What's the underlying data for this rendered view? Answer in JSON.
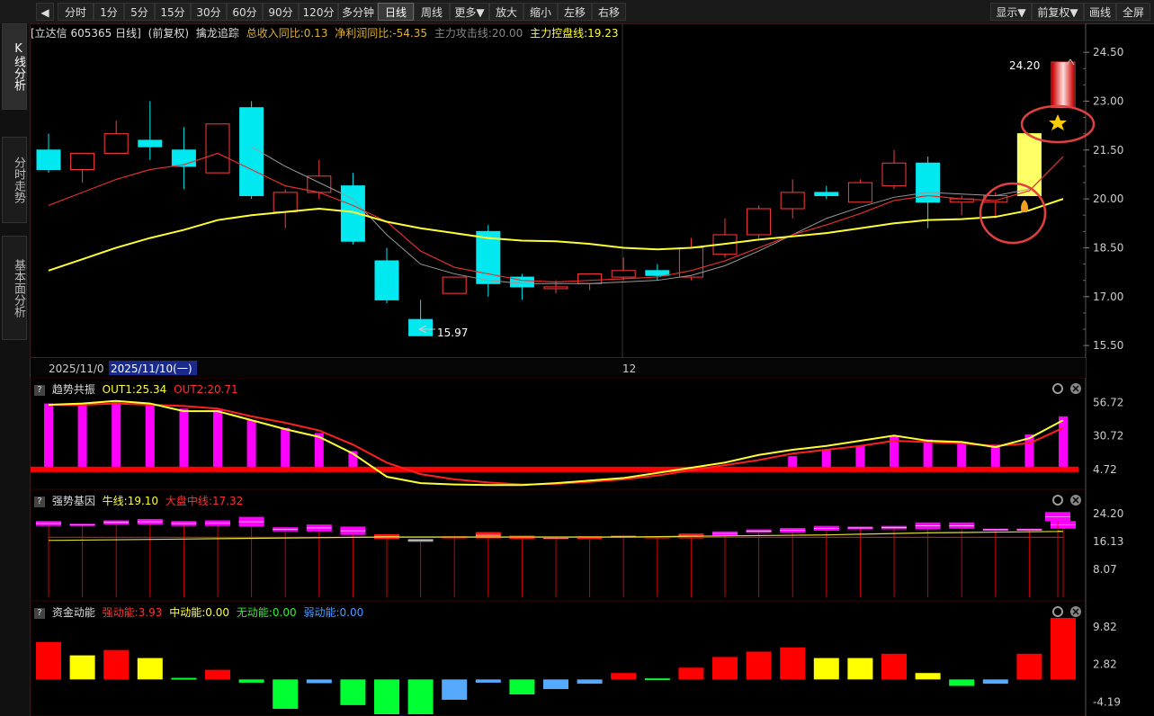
{
  "toolbar": {
    "back_icon": "back-arrow-icon",
    "buttons": [
      "分时",
      "1分",
      "5分",
      "15分",
      "30分",
      "60分",
      "90分",
      "120分",
      "多分钟",
      "日线",
      "周线",
      "更多▼",
      "放大",
      "缩小",
      "左移",
      "右移"
    ],
    "active": "日线",
    "right_buttons": [
      "显示▼",
      "前复权▼",
      "画线",
      "全屏"
    ]
  },
  "side_tabs": [
    "K线分析",
    "分时走势",
    "基本面分析"
  ],
  "main_chart": {
    "header": {
      "stock": "[立达信 605365 日线]",
      "adjust": "(前复权)",
      "indicator": "擒龙追踪",
      "rev": "总收入同比:0.13",
      "profit": "净利润同比:-54.35",
      "attack": "主力攻击线:20.00",
      "control": "主力控盘线:19.23"
    },
    "y_labels": [
      "24.50",
      "23.00",
      "21.50",
      "20.00",
      "18.50",
      "17.00",
      "15.50"
    ],
    "high_label": "24.20",
    "low_label": "15.97",
    "date_label_1": "2025/11/0",
    "date_label_2": "2025/11/10(一)",
    "month_label": "12",
    "colors": {
      "up": "#ff3c3c",
      "down": "#00e8f0",
      "ma_yellow": "#ffff33",
      "ma_red": "#e03030",
      "ma_gray": "#9a9a9a",
      "circle": "#e04040"
    }
  },
  "chart_data": [
    {
      "type": "candlestick",
      "title": "",
      "ylim": [
        15.2,
        25.0
      ],
      "y_ticks": [
        24.5,
        23.0,
        21.5,
        20.0,
        18.5,
        17.0,
        15.5
      ],
      "candles": [
        {
          "o": 21.5,
          "h": 22.0,
          "l": 20.8,
          "c": 20.9
        },
        {
          "o": 20.9,
          "h": 21.4,
          "l": 20.5,
          "c": 21.4
        },
        {
          "o": 21.4,
          "h": 22.4,
          "l": 21.4,
          "c": 22.0
        },
        {
          "o": 21.8,
          "h": 23.0,
          "l": 21.2,
          "c": 21.6
        },
        {
          "o": 21.5,
          "h": 22.2,
          "l": 20.3,
          "c": 21.0
        },
        {
          "o": 20.8,
          "h": 22.3,
          "l": 20.8,
          "c": 22.3
        },
        {
          "o": 22.8,
          "h": 23.0,
          "l": 20.0,
          "c": 20.1
        },
        {
          "o": 19.6,
          "h": 20.3,
          "l": 19.1,
          "c": 20.2
        },
        {
          "o": 20.2,
          "h": 21.2,
          "l": 20.0,
          "c": 20.7
        },
        {
          "o": 20.4,
          "h": 20.8,
          "l": 18.6,
          "c": 18.7
        },
        {
          "o": 18.1,
          "h": 18.5,
          "l": 16.8,
          "c": 16.9
        },
        {
          "o": 16.3,
          "h": 16.9,
          "l": 15.97,
          "c": 15.8
        },
        {
          "o": 17.1,
          "h": 17.6,
          "l": 17.1,
          "c": 17.6
        },
        {
          "o": 19.0,
          "h": 19.2,
          "l": 17.0,
          "c": 17.4
        },
        {
          "o": 17.6,
          "h": 17.7,
          "l": 16.9,
          "c": 17.3
        },
        {
          "o": 17.3,
          "h": 17.5,
          "l": 17.1,
          "c": 17.3
        },
        {
          "o": 17.4,
          "h": 17.7,
          "l": 17.2,
          "c": 17.7
        },
        {
          "o": 17.6,
          "h": 18.2,
          "l": 17.5,
          "c": 17.8
        },
        {
          "o": 17.8,
          "h": 18.0,
          "l": 17.5,
          "c": 17.65
        },
        {
          "o": 17.6,
          "h": 18.8,
          "l": 17.5,
          "c": 18.5
        },
        {
          "o": 18.3,
          "h": 19.4,
          "l": 18.2,
          "c": 18.9
        },
        {
          "o": 18.9,
          "h": 19.8,
          "l": 18.8,
          "c": 19.7
        },
        {
          "o": 19.7,
          "h": 20.6,
          "l": 19.4,
          "c": 20.2
        },
        {
          "o": 20.2,
          "h": 20.4,
          "l": 20.0,
          "c": 20.1
        },
        {
          "o": 19.9,
          "h": 20.6,
          "l": 19.9,
          "c": 20.5
        },
        {
          "o": 20.4,
          "h": 21.5,
          "l": 20.3,
          "c": 21.1
        },
        {
          "o": 21.1,
          "h": 21.3,
          "l": 19.1,
          "c": 19.9
        },
        {
          "o": 19.9,
          "h": 20.1,
          "l": 19.5,
          "c": 20.0
        },
        {
          "o": 19.9,
          "h": 20.2,
          "l": 19.4,
          "c": 20.1
        },
        {
          "o": 22.0,
          "h": 22.0,
          "l": 20.1,
          "c": 20.1
        },
        {
          "o": 22.8,
          "h": 24.2,
          "l": 22.8,
          "c": 24.2
        }
      ],
      "ma_yellow": [
        17.8,
        18.15,
        18.5,
        18.8,
        19.05,
        19.35,
        19.5,
        19.6,
        19.7,
        19.6,
        19.3,
        19.1,
        18.95,
        18.8,
        18.72,
        18.7,
        18.62,
        18.5,
        18.45,
        18.5,
        18.62,
        18.75,
        18.85,
        18.95,
        19.1,
        19.25,
        19.35,
        19.38,
        19.45,
        19.65,
        20.0
      ],
      "ma_red": [
        19.8,
        20.2,
        20.6,
        20.9,
        21.05,
        21.4,
        20.9,
        20.4,
        20.2,
        19.8,
        19.3,
        18.4,
        17.9,
        17.7,
        17.5,
        17.45,
        17.5,
        17.55,
        17.6,
        17.8,
        18.1,
        18.5,
        18.9,
        19.2,
        19.55,
        19.95,
        20.1,
        20.0,
        19.95,
        20.25,
        21.3
      ],
      "ma_gray": [
        null,
        null,
        null,
        null,
        null,
        null,
        21.6,
        21.0,
        20.5,
        20.0,
        18.9,
        18.0,
        17.7,
        17.5,
        17.4,
        17.4,
        17.4,
        17.45,
        17.5,
        17.65,
        17.95,
        18.4,
        18.9,
        19.4,
        19.75,
        20.05,
        20.2,
        20.15,
        20.1,
        20.3,
        null
      ]
    },
    {
      "type": "bar",
      "title": "趋势共振",
      "out1_label": "OUT1:25.34",
      "out2_label": "OUT2:20.71",
      "y_labels": [
        "56.72",
        "30.72",
        "4.72"
      ],
      "ylim": [
        -8,
        62
      ],
      "baseline": 4.72,
      "bars": [
        56.0,
        56.0,
        57.0,
        55.0,
        52.0,
        51.0,
        43.0,
        37.0,
        33.0,
        19.0,
        null,
        null,
        null,
        null,
        null,
        null,
        null,
        null,
        null,
        null,
        null,
        6.5,
        15.0,
        20.0,
        23.0,
        31.0,
        28.0,
        25.0,
        24.0,
        32.0,
        46.0
      ],
      "out1": [
        55.0,
        56.0,
        58.0,
        56.0,
        50.0,
        50.0,
        43.0,
        36.0,
        30.0,
        17.0,
        -1.0,
        -6.0,
        -7.0,
        -7.5,
        -7.5,
        -6.0,
        -4.0,
        -2.0,
        2.0,
        6.0,
        10.0,
        16.0,
        20.0,
        23.0,
        27.0,
        31.0,
        27.0,
        26.0,
        22.0,
        29.0,
        43.0
      ],
      "out2": [
        55.0,
        55.0,
        56.0,
        55.0,
        54.0,
        52.0,
        46.0,
        41.0,
        35.0,
        24.0,
        10.0,
        1.0,
        -3.0,
        -5.5,
        -7.0,
        -6.5,
        -5.0,
        -3.0,
        0.0,
        4.0,
        8.0,
        12.0,
        17.0,
        20.0,
        23.0,
        27.0,
        26.0,
        25.0,
        23.0,
        25.0,
        37.0
      ]
    },
    {
      "type": "bar",
      "title": "强势基因",
      "bull_label": "牛线:19.10",
      "market_label": "大盘中线:17.32",
      "y_labels": [
        "24.20",
        "16.13",
        "8.07"
      ],
      "ylim": [
        0,
        27
      ],
      "boxes": [
        {
          "t": 22.0,
          "b": 20.6,
          "k": "m"
        },
        {
          "t": 21.2,
          "b": 20.6,
          "k": "m"
        },
        {
          "t": 22.2,
          "b": 21.0,
          "k": "m"
        },
        {
          "t": 22.6,
          "b": 21.0,
          "k": "m"
        },
        {
          "t": 22.0,
          "b": 20.6,
          "k": "m"
        },
        {
          "t": 22.2,
          "b": 20.6,
          "k": "m"
        },
        {
          "t": 23.2,
          "b": 20.4,
          "k": "m"
        },
        {
          "t": 20.2,
          "b": 19.0,
          "k": "m"
        },
        {
          "t": 21.0,
          "b": 19.0,
          "k": "m"
        },
        {
          "t": 20.4,
          "b": 18.0,
          "k": "m"
        },
        {
          "t": 18.2,
          "b": 16.8,
          "k": "r"
        },
        {
          "t": 16.8,
          "b": 16.0,
          "k": "g"
        },
        {
          "t": 17.6,
          "b": 17.0,
          "k": "r"
        },
        {
          "t": 18.8,
          "b": 17.0,
          "k": "r"
        },
        {
          "t": 17.8,
          "b": 16.8,
          "k": "r"
        },
        {
          "t": 17.4,
          "b": 16.8,
          "k": "r"
        },
        {
          "t": 17.6,
          "b": 16.8,
          "k": "r"
        },
        {
          "t": 17.8,
          "b": 17.2,
          "k": "r"
        },
        {
          "t": 17.6,
          "b": 17.0,
          "k": "r"
        },
        {
          "t": 18.4,
          "b": 17.0,
          "k": "r"
        },
        {
          "t": 19.0,
          "b": 17.8,
          "k": "m"
        },
        {
          "t": 19.6,
          "b": 18.6,
          "k": "m"
        },
        {
          "t": 20.0,
          "b": 18.6,
          "k": "m"
        },
        {
          "t": 20.6,
          "b": 19.2,
          "k": "m"
        },
        {
          "t": 20.4,
          "b": 19.6,
          "k": "m"
        },
        {
          "t": 20.6,
          "b": 19.6,
          "k": "m"
        },
        {
          "t": 21.6,
          "b": 19.6,
          "k": "m"
        },
        {
          "t": 21.6,
          "b": 19.8,
          "k": "m"
        },
        {
          "t": 19.8,
          "b": 19.2,
          "k": "m"
        },
        {
          "t": 19.8,
          "b": 19.2,
          "k": "m"
        },
        {
          "t": 22.0,
          "b": 19.8,
          "k": "m"
        },
        {
          "t": 24.6,
          "b": 22.0,
          "k": "m"
        }
      ],
      "bull_line": [
        16.4,
        16.5,
        16.6,
        16.7,
        16.8,
        16.9,
        17.0,
        17.1,
        17.2,
        17.3,
        17.4,
        17.4,
        17.4,
        17.4,
        17.4,
        17.4,
        17.4,
        17.4,
        17.5,
        17.6,
        17.7,
        17.8,
        17.9,
        18.0,
        18.2,
        18.4,
        18.6,
        18.7,
        18.8,
        18.9,
        19.0,
        19.1
      ],
      "market_line": [
        17.3,
        17.3,
        17.3,
        17.3,
        17.3,
        17.3,
        17.3,
        17.3,
        17.3,
        17.3,
        17.3,
        17.3,
        17.3,
        17.3,
        17.3,
        17.3,
        17.3,
        17.3,
        17.3,
        17.3,
        17.3,
        17.3,
        17.3,
        17.3,
        17.3,
        17.3,
        17.3,
        17.3,
        17.3,
        17.3,
        17.3,
        17.32
      ]
    },
    {
      "type": "bar",
      "title": "资金动能",
      "strong_label": "强动能:3.93",
      "mid_label": "中动能:0.00",
      "none_label": "无动能:0.00",
      "weak_label": "弱动能:0.00",
      "y_labels": [
        "9.82",
        "2.82",
        "-4.19"
      ],
      "ylim": [
        -6.5,
        12
      ],
      "bars": [
        {
          "v": 7.0,
          "k": "r"
        },
        {
          "v": 4.5,
          "k": "y"
        },
        {
          "v": 5.5,
          "k": "r"
        },
        {
          "v": 4.0,
          "k": "y"
        },
        {
          "v": 0.3,
          "k": "g"
        },
        {
          "v": 1.8,
          "k": "r"
        },
        {
          "v": -0.6,
          "k": "g"
        },
        {
          "v": -5.5,
          "k": "g"
        },
        {
          "v": -0.7,
          "k": "b"
        },
        {
          "v": -4.8,
          "k": "g"
        },
        {
          "v": -10.5,
          "k": "g"
        },
        {
          "v": -11.5,
          "k": "g"
        },
        {
          "v": -3.8,
          "k": "b"
        },
        {
          "v": -0.6,
          "k": "b"
        },
        {
          "v": -2.8,
          "k": "g"
        },
        {
          "v": -1.8,
          "k": "b"
        },
        {
          "v": -0.8,
          "k": "b"
        },
        {
          "v": 1.2,
          "k": "r"
        },
        {
          "v": 0.2,
          "k": "g"
        },
        {
          "v": 2.2,
          "k": "r"
        },
        {
          "v": 4.2,
          "k": "r"
        },
        {
          "v": 5.2,
          "k": "r"
        },
        {
          "v": 6.0,
          "k": "r"
        },
        {
          "v": 4.0,
          "k": "y"
        },
        {
          "v": 4.0,
          "k": "y"
        },
        {
          "v": 4.8,
          "k": "r"
        },
        {
          "v": 1.2,
          "k": "y"
        },
        {
          "v": -1.2,
          "k": "g"
        },
        {
          "v": -0.8,
          "k": "b"
        },
        {
          "v": 4.8,
          "k": "r"
        },
        {
          "v": 11.5,
          "k": "r"
        }
      ]
    }
  ],
  "panel_icons": {
    "settings": "gear-icon",
    "close": "close-icon",
    "help": "?"
  }
}
